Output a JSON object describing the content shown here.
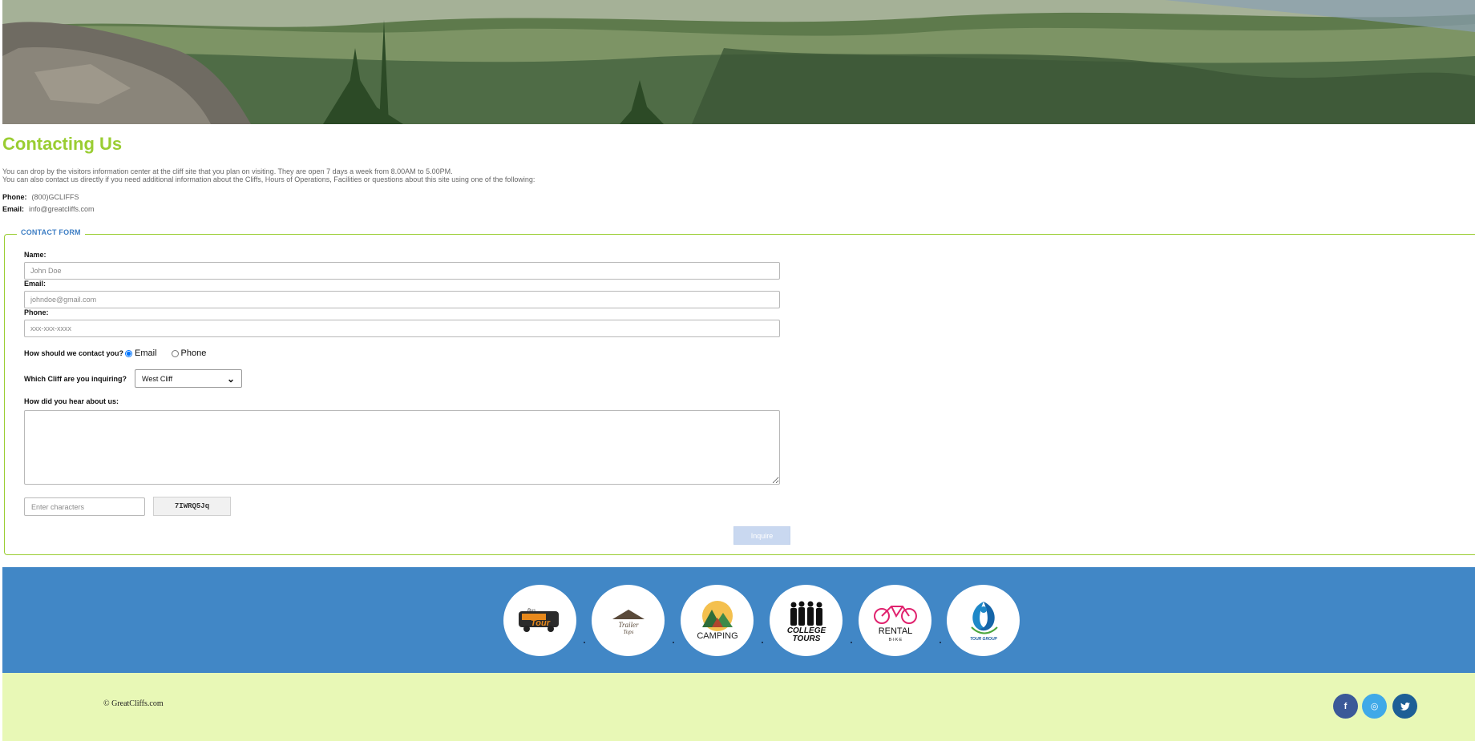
{
  "page": {
    "title": "Contacting Us",
    "intro": [
      "You can drop by the visitors information center at the cliff site that you plan on visiting. They are open 7 days a week from 8.00AM to 5.00PM.",
      "You can also contact us directly if you need additional information about the Cliffs, Hours of Operations, Facilities or questions about this site using one of the following:"
    ],
    "contact": {
      "phone_label": "Phone:",
      "phone_value": "(800)GCLIFFS",
      "email_label": "Email:",
      "email_value": "info@greatcliffs.com"
    }
  },
  "form": {
    "legend": "CONTACT FORM",
    "name_label": "Name:",
    "name_placeholder": "John Doe",
    "email_label": "Email:",
    "email_placeholder": "johndoe@gmail.com",
    "phone_label": "Phone:",
    "phone_placeholder": "xxx-xxx-xxxx",
    "contact_method_question": "How should we contact you?",
    "contact_options": [
      "Email",
      "Phone"
    ],
    "contact_selected": "Email",
    "cliff_question": "Which Cliff are you inquiring?",
    "cliff_selected": "West Cliff",
    "heard_question": "How did you hear about us:",
    "heard_value": "",
    "captcha_placeholder": "Enter characters",
    "captcha_code": "7IWRQ5Jq",
    "submit_label": "Inquire"
  },
  "partners": [
    {
      "name": "bus-tour-logo",
      "text_top": "Bus",
      "text_bottom": "Tour",
      "color": "#e8891c"
    },
    {
      "name": "trailer-tops-logo",
      "text_top": "Trailer",
      "text_bottom": "Tops",
      "color": "#5a4a3a"
    },
    {
      "name": "camping-logo",
      "text_top": "CAMPING",
      "text_bottom": "",
      "color": "#2f6d3a"
    },
    {
      "name": "college-tours-logo",
      "text_top": "COLLEGE",
      "text_bottom": "TOURS",
      "color": "#111111"
    },
    {
      "name": "rental-bike-logo",
      "text_top": "RENTAL",
      "text_bottom": "B·I·K·E",
      "color": "#e0226e"
    },
    {
      "name": "tour-group-logo",
      "text_top": "TOUR GROUP",
      "text_bottom": "",
      "color": "#1e88c8"
    }
  ],
  "footer": {
    "copyright": "© GreatCliffs.com",
    "social": [
      {
        "name": "facebook-icon",
        "glyph": "f",
        "color": "#3b5998"
      },
      {
        "name": "instagram-icon",
        "glyph": "◎",
        "color": "#3fa9e8"
      },
      {
        "name": "twitter-icon",
        "glyph": "✓",
        "color": "#1d5f96"
      }
    ]
  }
}
